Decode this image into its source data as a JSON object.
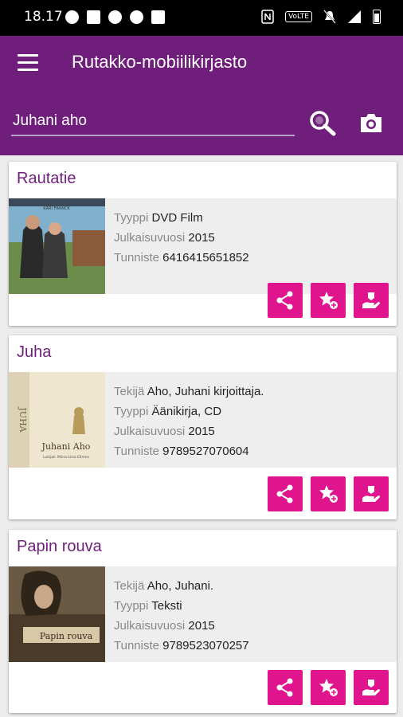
{
  "status_bar": {
    "time": "18.17",
    "network_badge": "VoLTE",
    "icons": [
      "b-circle-icon",
      "mail-icon",
      "keyhole-icon",
      "crosshair-icon",
      "square-icon",
      "nfc-icon",
      "mute-icon",
      "signal-icon",
      "battery-icon"
    ]
  },
  "app_bar": {
    "title": "Rutakko-mobiilikirjasto",
    "search_value": "Juhani aho",
    "menu_icon": "menu-icon",
    "search_icon": "search-icon",
    "camera_icon": "camera-icon"
  },
  "colors": {
    "primary": "#6f1f7b",
    "accent": "#e0148c"
  },
  "results": [
    {
      "title": "Rautatie",
      "cover_caption": "KARI FRANCK",
      "fields": [
        {
          "label": "Tyyppi",
          "value": "DVD Film"
        },
        {
          "label": "Julkaisuvuosi",
          "value": "2015"
        },
        {
          "label": "Tunniste",
          "value": "6416415651852"
        }
      ]
    },
    {
      "title": "Juha",
      "cover_caption": "Juhani Aho",
      "cover_spine": "JUHA",
      "cover_sub": "Lukijat: Miina-Liisa Ellmes",
      "fields": [
        {
          "label": "Tekijä",
          "value": "Aho, Juhani kirjoittaja."
        },
        {
          "label": "Tyyppi",
          "value": "Äänikirja, CD"
        },
        {
          "label": "Julkaisuvuosi",
          "value": "2015"
        },
        {
          "label": "Tunniste",
          "value": "9789527070604"
        }
      ]
    },
    {
      "title": "Papin rouva",
      "cover_caption": "Papin rouva",
      "fields": [
        {
          "label": "Tekijä",
          "value": "Aho, Juhani."
        },
        {
          "label": "Tyyppi",
          "value": "Teksti"
        },
        {
          "label": "Julkaisuvuosi",
          "value": "2015"
        },
        {
          "label": "Tunniste",
          "value": "9789523070257"
        }
      ]
    }
  ],
  "actions": [
    "share-icon",
    "favorite-add-icon",
    "reserve-hand-icon"
  ]
}
